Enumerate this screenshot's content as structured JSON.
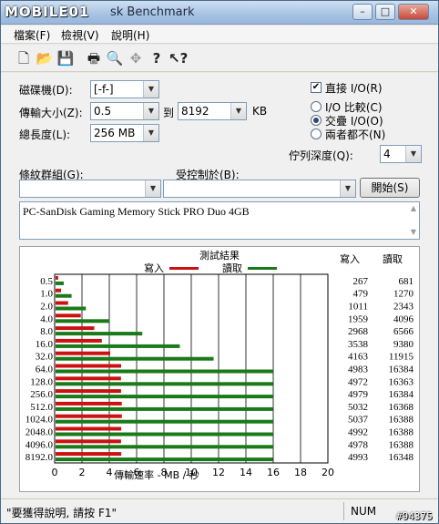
{
  "window": {
    "logo_text": "MOBILE01",
    "title": "sk Benchmark",
    "minimize": "–",
    "maximize": "□",
    "close": "✕"
  },
  "menu": [
    "檔案(F)",
    "檢視(V)",
    "說明(H)"
  ],
  "toolbar": {
    "icons": [
      "new-file-icon",
      "open-folder-icon",
      "save-icon",
      "print-icon",
      "print-preview-icon",
      "move-icon",
      "help-icon",
      "context-help-icon"
    ]
  },
  "form": {
    "drive_label": "磁碟機(D):",
    "drive_value": "[-f-]",
    "transfer_label": "傳輸大小(Z):",
    "transfer_from": "0.5",
    "transfer_to_label": "到",
    "transfer_to": "8192",
    "transfer_unit": "KB",
    "length_label": "總長度(L):",
    "length_value": "256 MB",
    "direct_io_label": "直接 I/O(R)",
    "direct_io_checked": true,
    "radio_compare": "I/O 比較(C)",
    "radio_overlap": "交疊 I/O(O)",
    "radio_neither": "兩者都不(N)",
    "radio_selected": "overlap",
    "queue_label": "佇列深度(Q):",
    "queue_value": "4",
    "stripe_label": "條紋群組(G):",
    "stripe_value": "",
    "controlled_label": "受控制於(B):",
    "controlled_value": "",
    "start_button": "開始(S)",
    "description": "PC-SanDisk Gaming Memory Stick PRO Duo 4GB"
  },
  "chart_data": {
    "type": "bar",
    "title": "測試結果",
    "orientation": "horizontal",
    "categories": [
      "0.5",
      "1.0",
      "2.0",
      "4.0",
      "8.0",
      "16.0",
      "32.0",
      "64.0",
      "128.0",
      "256.0",
      "512.0",
      "1024.0",
      "2048.0",
      "4096.0",
      "8192.0"
    ],
    "series": [
      {
        "name": "寫入",
        "color": "#cc1111",
        "values": [
          267,
          479,
          1011,
          1959,
          2968,
          3538,
          4163,
          4983,
          4972,
          4979,
          5032,
          5037,
          4992,
          4978,
          4993
        ]
      },
      {
        "name": "讀取",
        "color": "#1a7a1a",
        "values": [
          681,
          1270,
          2343,
          4096,
          6566,
          9380,
          11915,
          16384,
          16363,
          16384,
          16368,
          16388,
          16388,
          16388,
          16348
        ]
      }
    ],
    "xlabel": "傳輸速率 - MB / 秒",
    "xticks": [
      "0",
      "2",
      "4",
      "6",
      "8",
      "10",
      "12",
      "14",
      "16",
      "18",
      "20"
    ],
    "xlim": [
      0,
      20
    ],
    "table_headers": [
      "寫入",
      "讀取"
    ],
    "grid": true,
    "legend_position": "top"
  },
  "statusbar": {
    "hint": "\"要獲得說明, 請按 F1\"",
    "num": "NUM"
  },
  "watermark": "#94375"
}
